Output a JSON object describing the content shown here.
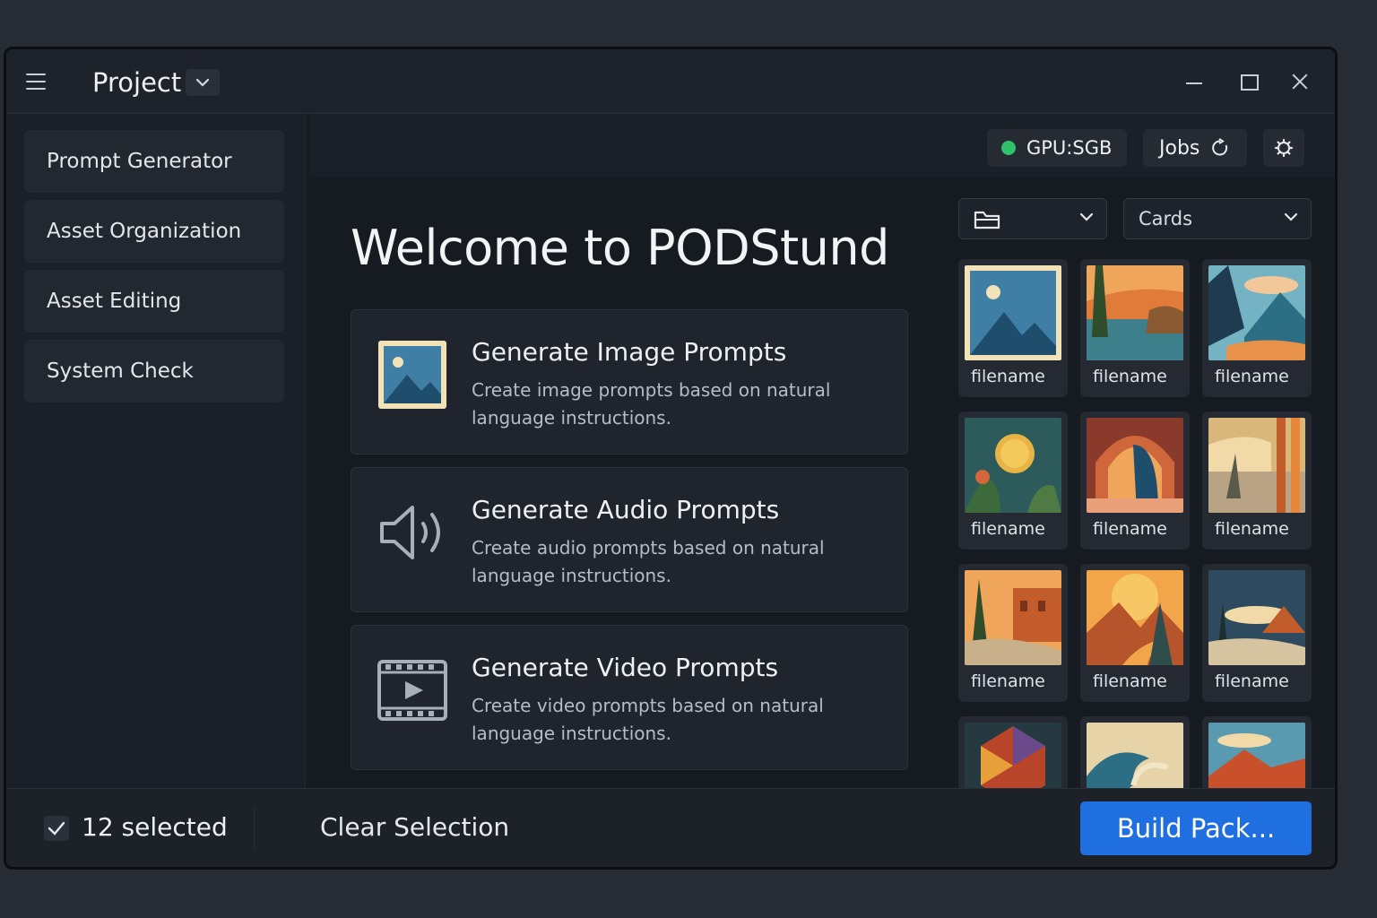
{
  "titlebar": {
    "project_label": "Project"
  },
  "sidebar": {
    "items": [
      {
        "label": "Prompt Generator"
      },
      {
        "label": "Asset Organization"
      },
      {
        "label": "Asset Editing"
      },
      {
        "label": "System Check"
      }
    ]
  },
  "status": {
    "gpu_label": "GPU:SGB",
    "gpu_status_color": "#2fc26a",
    "jobs_label": "Jobs"
  },
  "main": {
    "welcome_title": "Welcome to PODStund",
    "cards": [
      {
        "title": "Generate Image Prompts",
        "description": "Create image prompts based on natural language instructions.",
        "icon": "image-icon"
      },
      {
        "title": "Generate Audio Prompts",
        "description": "Create audio prompts based on natural language instructions.",
        "icon": "speaker-icon"
      },
      {
        "title": "Generate Video Prompts",
        "description": "Create video prompts based on natural language instructions.",
        "icon": "film-icon"
      }
    ]
  },
  "browser": {
    "folder_icon": "folder-icon",
    "view_mode": "Cards",
    "thumbnails": [
      {
        "label": "filename"
      },
      {
        "label": "filename"
      },
      {
        "label": "filename"
      },
      {
        "label": "filename"
      },
      {
        "label": "filename"
      },
      {
        "label": "filename"
      },
      {
        "label": "filename"
      },
      {
        "label": "filename"
      },
      {
        "label": "filename"
      },
      {
        "label": ""
      },
      {
        "label": ""
      },
      {
        "label": ""
      }
    ]
  },
  "footer": {
    "selected_count": "12 selected",
    "clear_label": "Clear Selection",
    "build_label": "Build Pack..."
  },
  "colors": {
    "accent": "#1f6fe0",
    "background": "#161a21"
  }
}
